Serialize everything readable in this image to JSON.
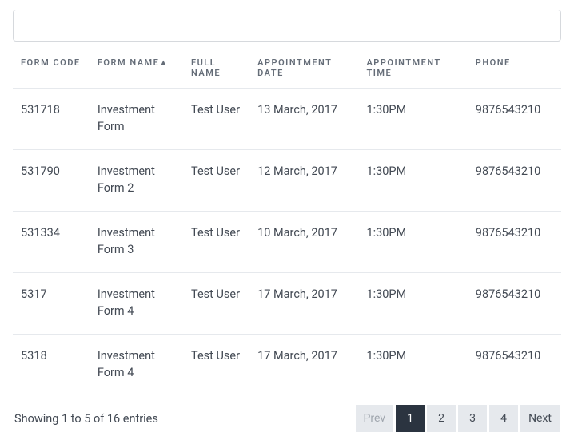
{
  "search": {
    "value": "",
    "placeholder": ""
  },
  "columns": {
    "form_code": "FORM CODE",
    "form_name": "FORM NAME",
    "full_name": "FULL NAME",
    "appointment_date": "APPOINTMENT DATE",
    "appointment_time": "APPOINTMENT TIME",
    "phone": "PHONE",
    "sort_indicator": "▲"
  },
  "rows": [
    {
      "form_code": "531718",
      "form_name": "Investment Form",
      "full_name": "Test User",
      "appointment_date": "13 March, 2017",
      "appointment_time": "1:30PM",
      "phone": "9876543210"
    },
    {
      "form_code": "531790",
      "form_name": "Investment Form 2",
      "full_name": "Test User",
      "appointment_date": "12 March, 2017",
      "appointment_time": "1:30PM",
      "phone": "9876543210"
    },
    {
      "form_code": "531334",
      "form_name": "Investment Form 3",
      "full_name": "Test User",
      "appointment_date": "10 March, 2017",
      "appointment_time": "1:30PM",
      "phone": "9876543210"
    },
    {
      "form_code": "5317",
      "form_name": "Investment Form 4",
      "full_name": "Test User",
      "appointment_date": "17 March, 2017",
      "appointment_time": "1:30PM",
      "phone": "9876543210"
    },
    {
      "form_code": "5318",
      "form_name": "Investment Form 4",
      "full_name": "Test User",
      "appointment_date": "17 March, 2017",
      "appointment_time": "1:30PM",
      "phone": "9876543210"
    }
  ],
  "info": "Showing 1 to 5 of 16 entries",
  "pagination": {
    "prev": "Prev",
    "next": "Next",
    "pages": [
      "1",
      "2",
      "3",
      "4"
    ],
    "active": "1"
  }
}
